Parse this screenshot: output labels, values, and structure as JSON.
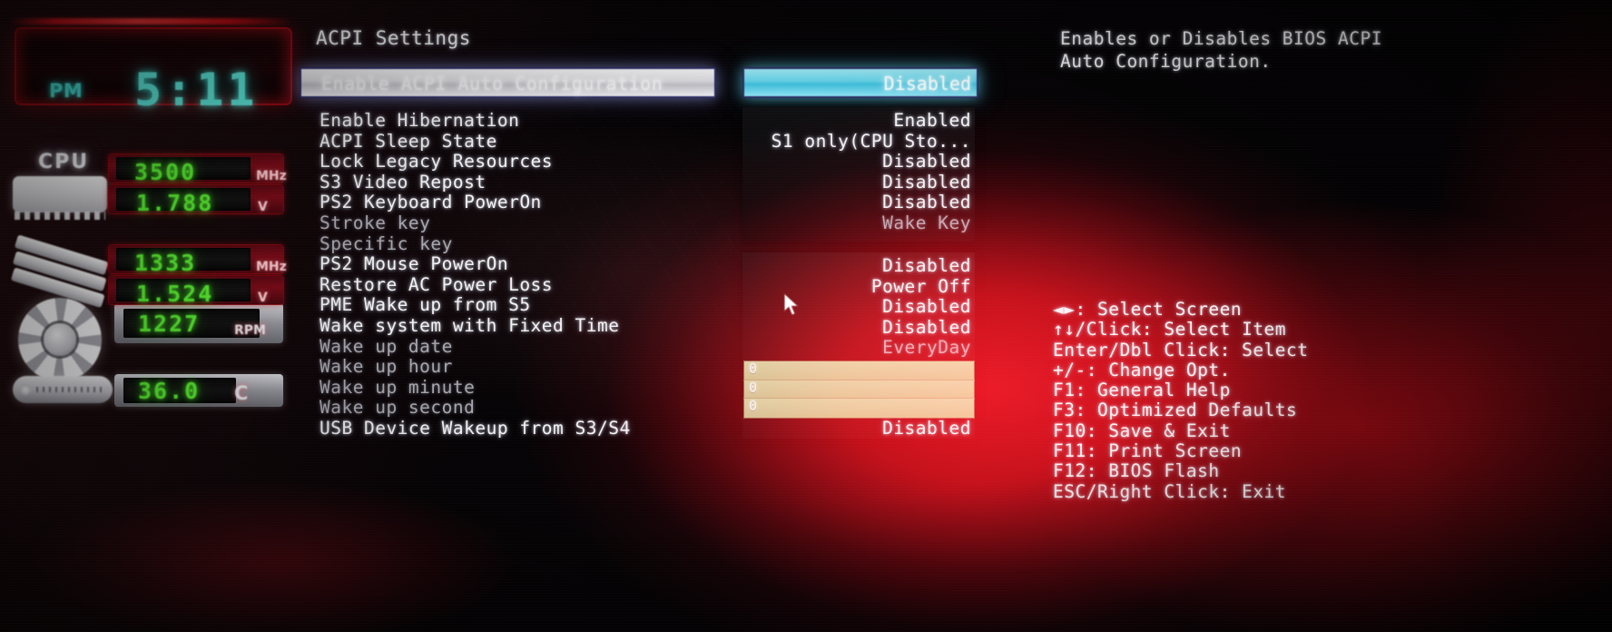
{
  "hwmon": {
    "clock": {
      "meridiem": "PM",
      "time": "5:11"
    },
    "cpu_label": "CPU",
    "sensors": [
      {
        "name": "cpu-frequency",
        "value": "3500",
        "unit": "MHz"
      },
      {
        "name": "cpu-voltage",
        "value": "1.788",
        "unit": "V"
      },
      {
        "name": "memory-frequency",
        "value": "1333",
        "unit": "MHz"
      },
      {
        "name": "memory-voltage",
        "value": "1.524",
        "unit": "V"
      },
      {
        "name": "fan-speed",
        "value": "1227",
        "unit": "RPM"
      },
      {
        "name": "temperature",
        "value": "36.0",
        "unit": "C"
      }
    ],
    "colors": {
      "clock": "#5ef0e2",
      "led": "#5dfb33",
      "bar": "#7d0c18"
    }
  },
  "panel": {
    "title": "ACPI Settings",
    "selected": {
      "label": "Enable ACPI Auto Configuration",
      "value": "Disabled"
    },
    "settings": [
      {
        "label": "Enable Hibernation",
        "value": "Enabled",
        "dim": false
      },
      {
        "label": "ACPI Sleep State",
        "value": "S1 only(CPU Sto...",
        "dim": false
      },
      {
        "label": "Lock Legacy Resources",
        "value": "Disabled",
        "dim": false
      },
      {
        "label": "S3 Video Repost",
        "value": "Disabled",
        "dim": false
      },
      {
        "label": "PS2 Keyboard PowerOn",
        "value": "Disabled",
        "dim": false
      },
      {
        "label": "Stroke key",
        "value": "Wake Key",
        "dim": true
      },
      {
        "label": "Specific key",
        "value": "",
        "dim": true
      },
      {
        "label": "PS2 Mouse PowerOn",
        "value": "Disabled",
        "dim": false
      },
      {
        "label": "Restore AC Power Loss",
        "value": "Power Off",
        "dim": false
      },
      {
        "label": "PME Wake up from S5",
        "value": "Disabled",
        "dim": false
      },
      {
        "label": "Wake system with Fixed Time",
        "value": "Disabled",
        "dim": false
      },
      {
        "label": "Wake up date",
        "value": "EveryDay",
        "dim": true
      },
      {
        "label": "Wake up hour",
        "value": "0",
        "dim": true
      },
      {
        "label": "Wake up minute",
        "value": "0",
        "dim": true
      },
      {
        "label": "Wake up second",
        "value": "0",
        "dim": true
      },
      {
        "label": "USB Device Wakeup from S3/S4",
        "value": "Disabled",
        "dim": false
      }
    ],
    "time_fields": [
      "0",
      "0",
      "0"
    ]
  },
  "help": {
    "lines": [
      "Enables or Disables BIOS ACPI",
      "Auto Configuration."
    ]
  },
  "legend": {
    "items": [
      "◄►: Select Screen",
      "↑↓/Click: Select Item",
      "Enter/Dbl Click: Select",
      "+/-: Change Opt.",
      "F1: General Help",
      "F3: Optimized Defaults",
      "F10: Save & Exit",
      "F11: Print Screen",
      "F12: BIOS Flash",
      "ESC/Right Click: Exit"
    ]
  }
}
